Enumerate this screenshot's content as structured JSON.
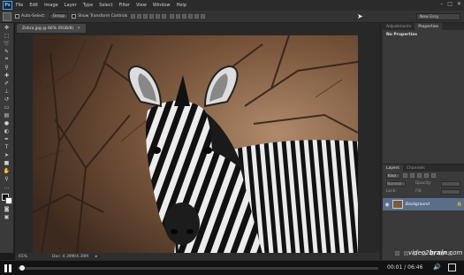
{
  "app": {
    "logo": "Ps"
  },
  "menu": [
    "File",
    "Edit",
    "Image",
    "Layer",
    "Type",
    "Select",
    "Filter",
    "View",
    "Window",
    "Help"
  ],
  "window_controls": [
    "–",
    "□",
    "✕"
  ],
  "options_bar": {
    "auto_select_label": "Auto-Select:",
    "auto_select_value": "Group",
    "show_transform_label": "Show Transform Controls",
    "workspace": "New Essy"
  },
  "document": {
    "tab_title": "Zebra.jpg @ 66% (RGB/8)",
    "zoom": "65%",
    "doc_size": "Doc: 4.39M/4.39M"
  },
  "panels": {
    "top_tabs": [
      "Adjustments",
      "Properties"
    ],
    "properties_message": "No Properties",
    "layer_tabs": [
      "Layers",
      "Channels"
    ],
    "kind_label": "Kind",
    "blend_mode": "Normal",
    "opacity_label": "Opacity:",
    "lock_label": "Lock:",
    "fill_label": "Fill:",
    "layer_name": "Background"
  },
  "player": {
    "time": "00:01 / 06:46",
    "watermark_pre": "video2",
    "watermark_bold": "brain",
    "watermark_post": ".com"
  }
}
